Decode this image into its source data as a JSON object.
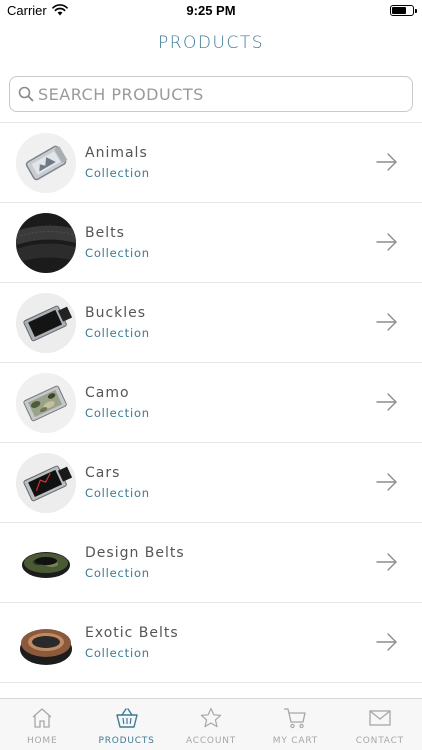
{
  "status_bar": {
    "carrier": "Carrier",
    "time": "9:25 PM",
    "battery_level": 0.7
  },
  "header": {
    "title": "PRODUCTS"
  },
  "search": {
    "placeholder": "SEARCH PRODUCTS",
    "value": ""
  },
  "products": [
    {
      "title": "Animals",
      "subtitle": "Collection",
      "thumb": "silver-buckle-animals"
    },
    {
      "title": "Belts",
      "subtitle": "Collection",
      "thumb": "black-leather-belt"
    },
    {
      "title": "Buckles",
      "subtitle": "Collection",
      "thumb": "black-buckle"
    },
    {
      "title": "Camo",
      "subtitle": "Collection",
      "thumb": "camo-buckle"
    },
    {
      "title": "Cars",
      "subtitle": "Collection",
      "thumb": "black-car-buckle"
    },
    {
      "title": "Design Belts",
      "subtitle": "Collection",
      "thumb": "camo-belt-roll"
    },
    {
      "title": "Exotic Belts",
      "subtitle": "Collection",
      "thumb": "brown-exotic-belt-roll"
    }
  ],
  "tabs": [
    {
      "label": "HOME",
      "icon": "home-icon",
      "active": false
    },
    {
      "label": "PRODUCTS",
      "icon": "basket-icon",
      "active": true
    },
    {
      "label": "ACCOUNT",
      "icon": "star-icon",
      "active": false
    },
    {
      "label": "MY CART",
      "icon": "cart-icon",
      "active": false
    },
    {
      "label": "CONTACT",
      "icon": "mail-icon",
      "active": false
    }
  ],
  "colors": {
    "accent": "#3d7a93",
    "inactive": "#a7a7a7",
    "divider": "#e6e6e6"
  }
}
